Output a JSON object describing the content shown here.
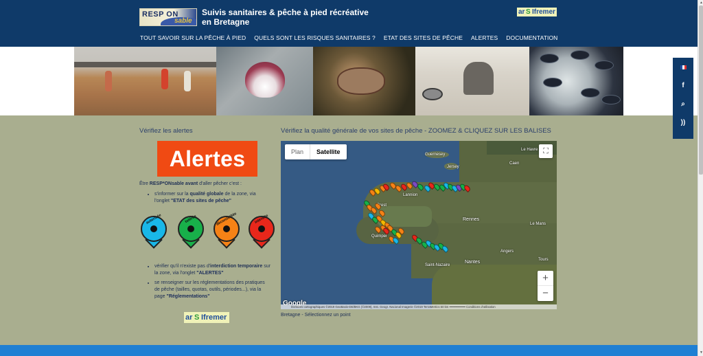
{
  "header": {
    "logo_text": "RESP ON",
    "logo_text2": "sable",
    "title": "Suivis sanitaires & pêche à pied récréative en Bretagne",
    "partner_logo": {
      "ars": "ar",
      "s": "S",
      "ifremer": "Ifremer"
    }
  },
  "nav": {
    "items": [
      "TOUT SAVOIR SUR LA PÊCHE À PIED",
      "QUELS SONT LES RISQUES SANITAIRES ?",
      "ETAT DES SITES DE PÊCHE",
      "ALERTES",
      "DOCUMENTATION"
    ]
  },
  "social": {
    "icons": [
      "flag-fr-icon",
      "facebook-icon",
      "search-icon",
      "rss-icon"
    ],
    "facebook_glyph": "f",
    "search_glyph": "⌕",
    "rss_glyph": "))"
  },
  "left": {
    "title": "Vérifiez les alertes",
    "alert_button": "Alertes",
    "intro_pre": "Être ",
    "intro_bold1": "RESP*ONsable avant",
    "intro_post": " d'aller pêcher c'est :",
    "bullet1_pre": "s'informer sur la ",
    "bullet1_bold": "qualité globale",
    "bullet1_mid": " de la zone, via l'onglet ",
    "bullet1_link": "\"ETAT des sites de pêche\"",
    "pins": [
      {
        "label": "autorisée",
        "color": "#19b7e8"
      },
      {
        "label": "tolérée",
        "color": "#18b04a"
      },
      {
        "label": "déconseillée",
        "color": "#f58216"
      },
      {
        "label": "interdite",
        "color": "#e8271b"
      }
    ],
    "bullet2_pre": "vérifier qu'il n'existe pas d'",
    "bullet2_bold": "interdiction temporaire",
    "bullet2_mid": " sur la zone, via l'onglet ",
    "bullet2_link": "\"ALERTES\"",
    "bullet3_pre": "se renseigner sur les réglementations des pratiques de pêche (tailles, quotas, outils, périodes...), via la page ",
    "bullet3_link": "\"Réglementations\""
  },
  "map": {
    "title": "Vérifiez la qualité générale de vos sites de pêche - ZOOMEZ & CLIQUEZ SUR LES BALISES",
    "type_plan": "Plan",
    "type_satellite": "Satellite",
    "zoom_in": "+",
    "zoom_out": "−",
    "fullscreen_glyph": "⛶",
    "labels": {
      "guernesey": "Guernesey",
      "jersey": "Jersey",
      "lehavre": "Le Havre",
      "caen": "Caen",
      "rennes": "Rennes",
      "nantes": "Nantes",
      "lemans": "Le Mans",
      "angers": "Angers",
      "tours": "Tours",
      "lannion": "Lannion",
      "saintnazaire": "Saint-Nazaire",
      "brest": "Brest",
      "quimper": "Quimper"
    },
    "google": "Google",
    "attribution": "Données cartographiques ©2019 GeoBasis-DE/BKG (©2009), Inst. Geogr. Nacional Imagerie ©2019 TerraMetrics   50 km ━━━━━━━━━   Conditions d'utilisation",
    "caption": "Bretagne - Sélectionnez un point",
    "marker_colors": [
      "#f58216",
      "#18b04a",
      "#19b7e8",
      "#e8271b",
      "#f6b900",
      "#7b4ac3"
    ]
  },
  "colors": {
    "header_bg": "#0f3a69",
    "page_bg": "#a9ae8f",
    "alert_orange": "#f04a13",
    "footer_blue": "#1f7fd3"
  }
}
